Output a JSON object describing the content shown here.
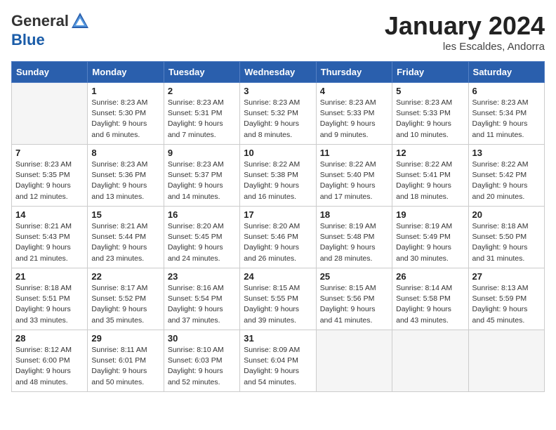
{
  "header": {
    "logo_general": "General",
    "logo_blue": "Blue",
    "month_title": "January 2024",
    "location": "les Escaldes, Andorra"
  },
  "days_of_week": [
    "Sunday",
    "Monday",
    "Tuesday",
    "Wednesday",
    "Thursday",
    "Friday",
    "Saturday"
  ],
  "weeks": [
    [
      {
        "num": "",
        "empty": true
      },
      {
        "num": "1",
        "sunrise": "Sunrise: 8:23 AM",
        "sunset": "Sunset: 5:30 PM",
        "daylight": "Daylight: 9 hours and 6 minutes."
      },
      {
        "num": "2",
        "sunrise": "Sunrise: 8:23 AM",
        "sunset": "Sunset: 5:31 PM",
        "daylight": "Daylight: 9 hours and 7 minutes."
      },
      {
        "num": "3",
        "sunrise": "Sunrise: 8:23 AM",
        "sunset": "Sunset: 5:32 PM",
        "daylight": "Daylight: 9 hours and 8 minutes."
      },
      {
        "num": "4",
        "sunrise": "Sunrise: 8:23 AM",
        "sunset": "Sunset: 5:33 PM",
        "daylight": "Daylight: 9 hours and 9 minutes."
      },
      {
        "num": "5",
        "sunrise": "Sunrise: 8:23 AM",
        "sunset": "Sunset: 5:33 PM",
        "daylight": "Daylight: 9 hours and 10 minutes."
      },
      {
        "num": "6",
        "sunrise": "Sunrise: 8:23 AM",
        "sunset": "Sunset: 5:34 PM",
        "daylight": "Daylight: 9 hours and 11 minutes."
      }
    ],
    [
      {
        "num": "7",
        "sunrise": "Sunrise: 8:23 AM",
        "sunset": "Sunset: 5:35 PM",
        "daylight": "Daylight: 9 hours and 12 minutes."
      },
      {
        "num": "8",
        "sunrise": "Sunrise: 8:23 AM",
        "sunset": "Sunset: 5:36 PM",
        "daylight": "Daylight: 9 hours and 13 minutes."
      },
      {
        "num": "9",
        "sunrise": "Sunrise: 8:23 AM",
        "sunset": "Sunset: 5:37 PM",
        "daylight": "Daylight: 9 hours and 14 minutes."
      },
      {
        "num": "10",
        "sunrise": "Sunrise: 8:22 AM",
        "sunset": "Sunset: 5:38 PM",
        "daylight": "Daylight: 9 hours and 16 minutes."
      },
      {
        "num": "11",
        "sunrise": "Sunrise: 8:22 AM",
        "sunset": "Sunset: 5:40 PM",
        "daylight": "Daylight: 9 hours and 17 minutes."
      },
      {
        "num": "12",
        "sunrise": "Sunrise: 8:22 AM",
        "sunset": "Sunset: 5:41 PM",
        "daylight": "Daylight: 9 hours and 18 minutes."
      },
      {
        "num": "13",
        "sunrise": "Sunrise: 8:22 AM",
        "sunset": "Sunset: 5:42 PM",
        "daylight": "Daylight: 9 hours and 20 minutes."
      }
    ],
    [
      {
        "num": "14",
        "sunrise": "Sunrise: 8:21 AM",
        "sunset": "Sunset: 5:43 PM",
        "daylight": "Daylight: 9 hours and 21 minutes."
      },
      {
        "num": "15",
        "sunrise": "Sunrise: 8:21 AM",
        "sunset": "Sunset: 5:44 PM",
        "daylight": "Daylight: 9 hours and 23 minutes."
      },
      {
        "num": "16",
        "sunrise": "Sunrise: 8:20 AM",
        "sunset": "Sunset: 5:45 PM",
        "daylight": "Daylight: 9 hours and 24 minutes."
      },
      {
        "num": "17",
        "sunrise": "Sunrise: 8:20 AM",
        "sunset": "Sunset: 5:46 PM",
        "daylight": "Daylight: 9 hours and 26 minutes."
      },
      {
        "num": "18",
        "sunrise": "Sunrise: 8:19 AM",
        "sunset": "Sunset: 5:48 PM",
        "daylight": "Daylight: 9 hours and 28 minutes."
      },
      {
        "num": "19",
        "sunrise": "Sunrise: 8:19 AM",
        "sunset": "Sunset: 5:49 PM",
        "daylight": "Daylight: 9 hours and 30 minutes."
      },
      {
        "num": "20",
        "sunrise": "Sunrise: 8:18 AM",
        "sunset": "Sunset: 5:50 PM",
        "daylight": "Daylight: 9 hours and 31 minutes."
      }
    ],
    [
      {
        "num": "21",
        "sunrise": "Sunrise: 8:18 AM",
        "sunset": "Sunset: 5:51 PM",
        "daylight": "Daylight: 9 hours and 33 minutes."
      },
      {
        "num": "22",
        "sunrise": "Sunrise: 8:17 AM",
        "sunset": "Sunset: 5:52 PM",
        "daylight": "Daylight: 9 hours and 35 minutes."
      },
      {
        "num": "23",
        "sunrise": "Sunrise: 8:16 AM",
        "sunset": "Sunset: 5:54 PM",
        "daylight": "Daylight: 9 hours and 37 minutes."
      },
      {
        "num": "24",
        "sunrise": "Sunrise: 8:15 AM",
        "sunset": "Sunset: 5:55 PM",
        "daylight": "Daylight: 9 hours and 39 minutes."
      },
      {
        "num": "25",
        "sunrise": "Sunrise: 8:15 AM",
        "sunset": "Sunset: 5:56 PM",
        "daylight": "Daylight: 9 hours and 41 minutes."
      },
      {
        "num": "26",
        "sunrise": "Sunrise: 8:14 AM",
        "sunset": "Sunset: 5:58 PM",
        "daylight": "Daylight: 9 hours and 43 minutes."
      },
      {
        "num": "27",
        "sunrise": "Sunrise: 8:13 AM",
        "sunset": "Sunset: 5:59 PM",
        "daylight": "Daylight: 9 hours and 45 minutes."
      }
    ],
    [
      {
        "num": "28",
        "sunrise": "Sunrise: 8:12 AM",
        "sunset": "Sunset: 6:00 PM",
        "daylight": "Daylight: 9 hours and 48 minutes."
      },
      {
        "num": "29",
        "sunrise": "Sunrise: 8:11 AM",
        "sunset": "Sunset: 6:01 PM",
        "daylight": "Daylight: 9 hours and 50 minutes."
      },
      {
        "num": "30",
        "sunrise": "Sunrise: 8:10 AM",
        "sunset": "Sunset: 6:03 PM",
        "daylight": "Daylight: 9 hours and 52 minutes."
      },
      {
        "num": "31",
        "sunrise": "Sunrise: 8:09 AM",
        "sunset": "Sunset: 6:04 PM",
        "daylight": "Daylight: 9 hours and 54 minutes."
      },
      {
        "num": "",
        "empty": true
      },
      {
        "num": "",
        "empty": true
      },
      {
        "num": "",
        "empty": true
      }
    ]
  ]
}
